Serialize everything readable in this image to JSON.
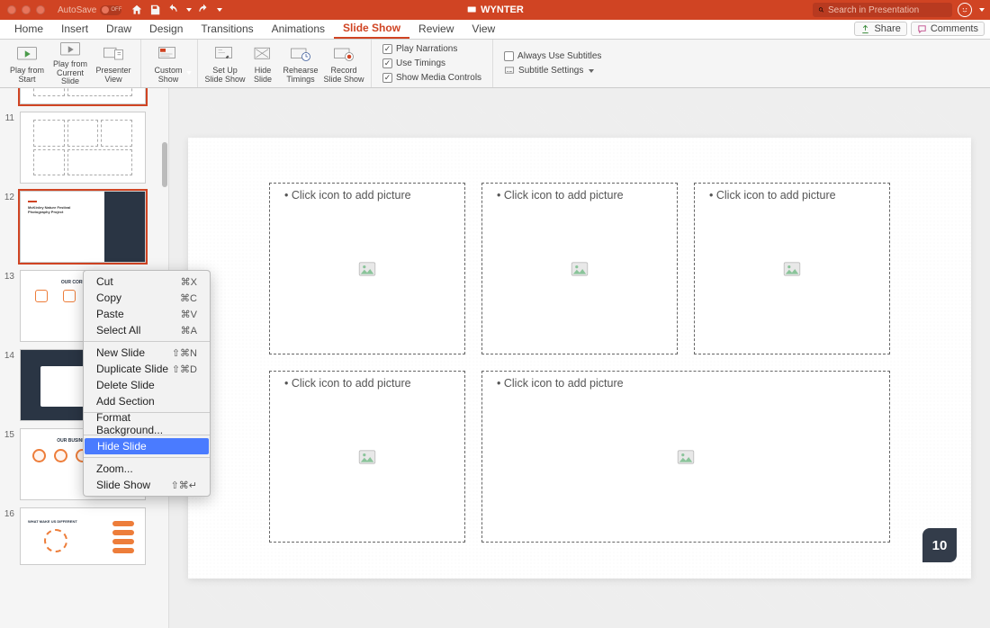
{
  "titlebar": {
    "autosave_label": "AutoSave",
    "autosave_state": "OFF",
    "doc_title": "WYNTER",
    "search_placeholder": "Search in Presentation"
  },
  "tabs": {
    "items": [
      "Home",
      "Insert",
      "Draw",
      "Design",
      "Transitions",
      "Animations",
      "Slide Show",
      "Review",
      "View"
    ],
    "active_index": 6,
    "share": "Share",
    "comments": "Comments"
  },
  "ribbon": {
    "play_start_l1": "Play from",
    "play_start_l2": "Start",
    "play_cur_l1": "Play from",
    "play_cur_l2": "Current Slide",
    "presenter_l1": "Presenter",
    "presenter_l2": "View",
    "custom_l1": "Custom",
    "custom_l2": "Show",
    "setup_l1": "Set Up",
    "setup_l2": "Slide Show",
    "hide_l1": "Hide",
    "hide_l2": "Slide",
    "rehearse_l1": "Rehearse",
    "rehearse_l2": "Timings",
    "record_l1": "Record",
    "record_l2": "Slide Show",
    "chk_narr": "Play Narrations",
    "chk_timings": "Use Timings",
    "chk_media": "Show Media Controls",
    "chk_subs": "Always Use Subtitles",
    "sub_settings": "Subtitle Settings"
  },
  "thumbs": {
    "n11": "11",
    "n12": "12",
    "n13": "13",
    "n14": "14",
    "n15": "15",
    "n16": "16",
    "t13_title": "OUR CORE VALUES",
    "t15_title": "OUR BUSINESS MODEL",
    "t16_title": "WHAT MAKE US DIFFERENT"
  },
  "slide": {
    "placeholder_label": "Click icon to add picture",
    "badge": "10"
  },
  "ctx": {
    "cut": "Cut",
    "cut_sc": "⌘X",
    "copy": "Copy",
    "copy_sc": "⌘C",
    "paste": "Paste",
    "paste_sc": "⌘V",
    "selall": "Select All",
    "selall_sc": "⌘A",
    "newslide": "New Slide",
    "newslide_sc": "⇧⌘N",
    "dup": "Duplicate Slide",
    "dup_sc": "⇧⌘D",
    "del": "Delete Slide",
    "addsec": "Add Section",
    "fmtbg": "Format Background...",
    "hide": "Hide Slide",
    "zoom": "Zoom...",
    "show": "Slide Show",
    "show_sc": "⇧⌘↵"
  }
}
